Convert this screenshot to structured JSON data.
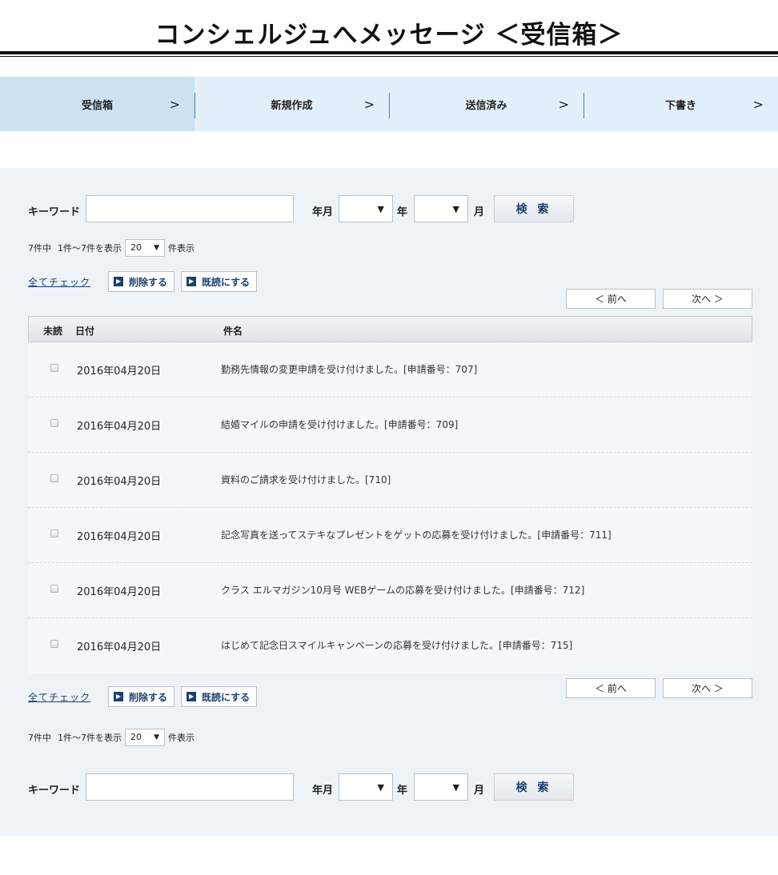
{
  "title": "コンシェルジュへメッセージ ＜受信箱＞",
  "steps": [
    {
      "label": "受信箱",
      "arrow": ">"
    },
    {
      "label": "新規作成",
      "arrow": ">"
    },
    {
      "label": "送信済み",
      "arrow": ">"
    },
    {
      "label": "下書き",
      "arrow": ">"
    }
  ],
  "search": {
    "keyword_label": "キーワード",
    "keyword_value": "",
    "yearmonth_label": "年月",
    "year_value": "",
    "year_label": "年",
    "month_value": "",
    "month_label": "月",
    "button_label": "検 索",
    "caret": "▼"
  },
  "count": {
    "total": "7件中",
    "range": "1件〜7件を表示",
    "per_page": "20",
    "suffix": "件表示",
    "caret": "▼"
  },
  "actions": {
    "check_all": "全てチェック",
    "delete": "削除する",
    "mark_read": "既読にする",
    "icon_glyph": "▶"
  },
  "pager": {
    "prev": "＜ 前へ",
    "next": "次へ ＞"
  },
  "table": {
    "headers": {
      "unread": "未読",
      "date": "日付",
      "subject": "件名"
    },
    "rows": [
      {
        "date": "2016年04月20日",
        "subject": "勤務先情報の変更申請を受け付けました。[申請番号：707]"
      },
      {
        "date": "2016年04月20日",
        "subject": "結婚マイルの申請を受け付けました。[申請番号：709]"
      },
      {
        "date": "2016年04月20日",
        "subject": "資料のご請求を受け付けました。[710]"
      },
      {
        "date": "2016年04月20日",
        "subject": "記念写真を送ってステキなプレゼントをゲットの応募を受け付けました。[申請番号：711]"
      },
      {
        "date": "2016年04月20日",
        "subject": "クラス エルマガジン10月号 WEBゲームの応募を受け付けました。[申請番号：712]"
      },
      {
        "date": "2016年04月20日",
        "subject": "はじめて記念日スマイルキャンペーンの応募を受け付けました。[申請番号：715]"
      }
    ]
  }
}
